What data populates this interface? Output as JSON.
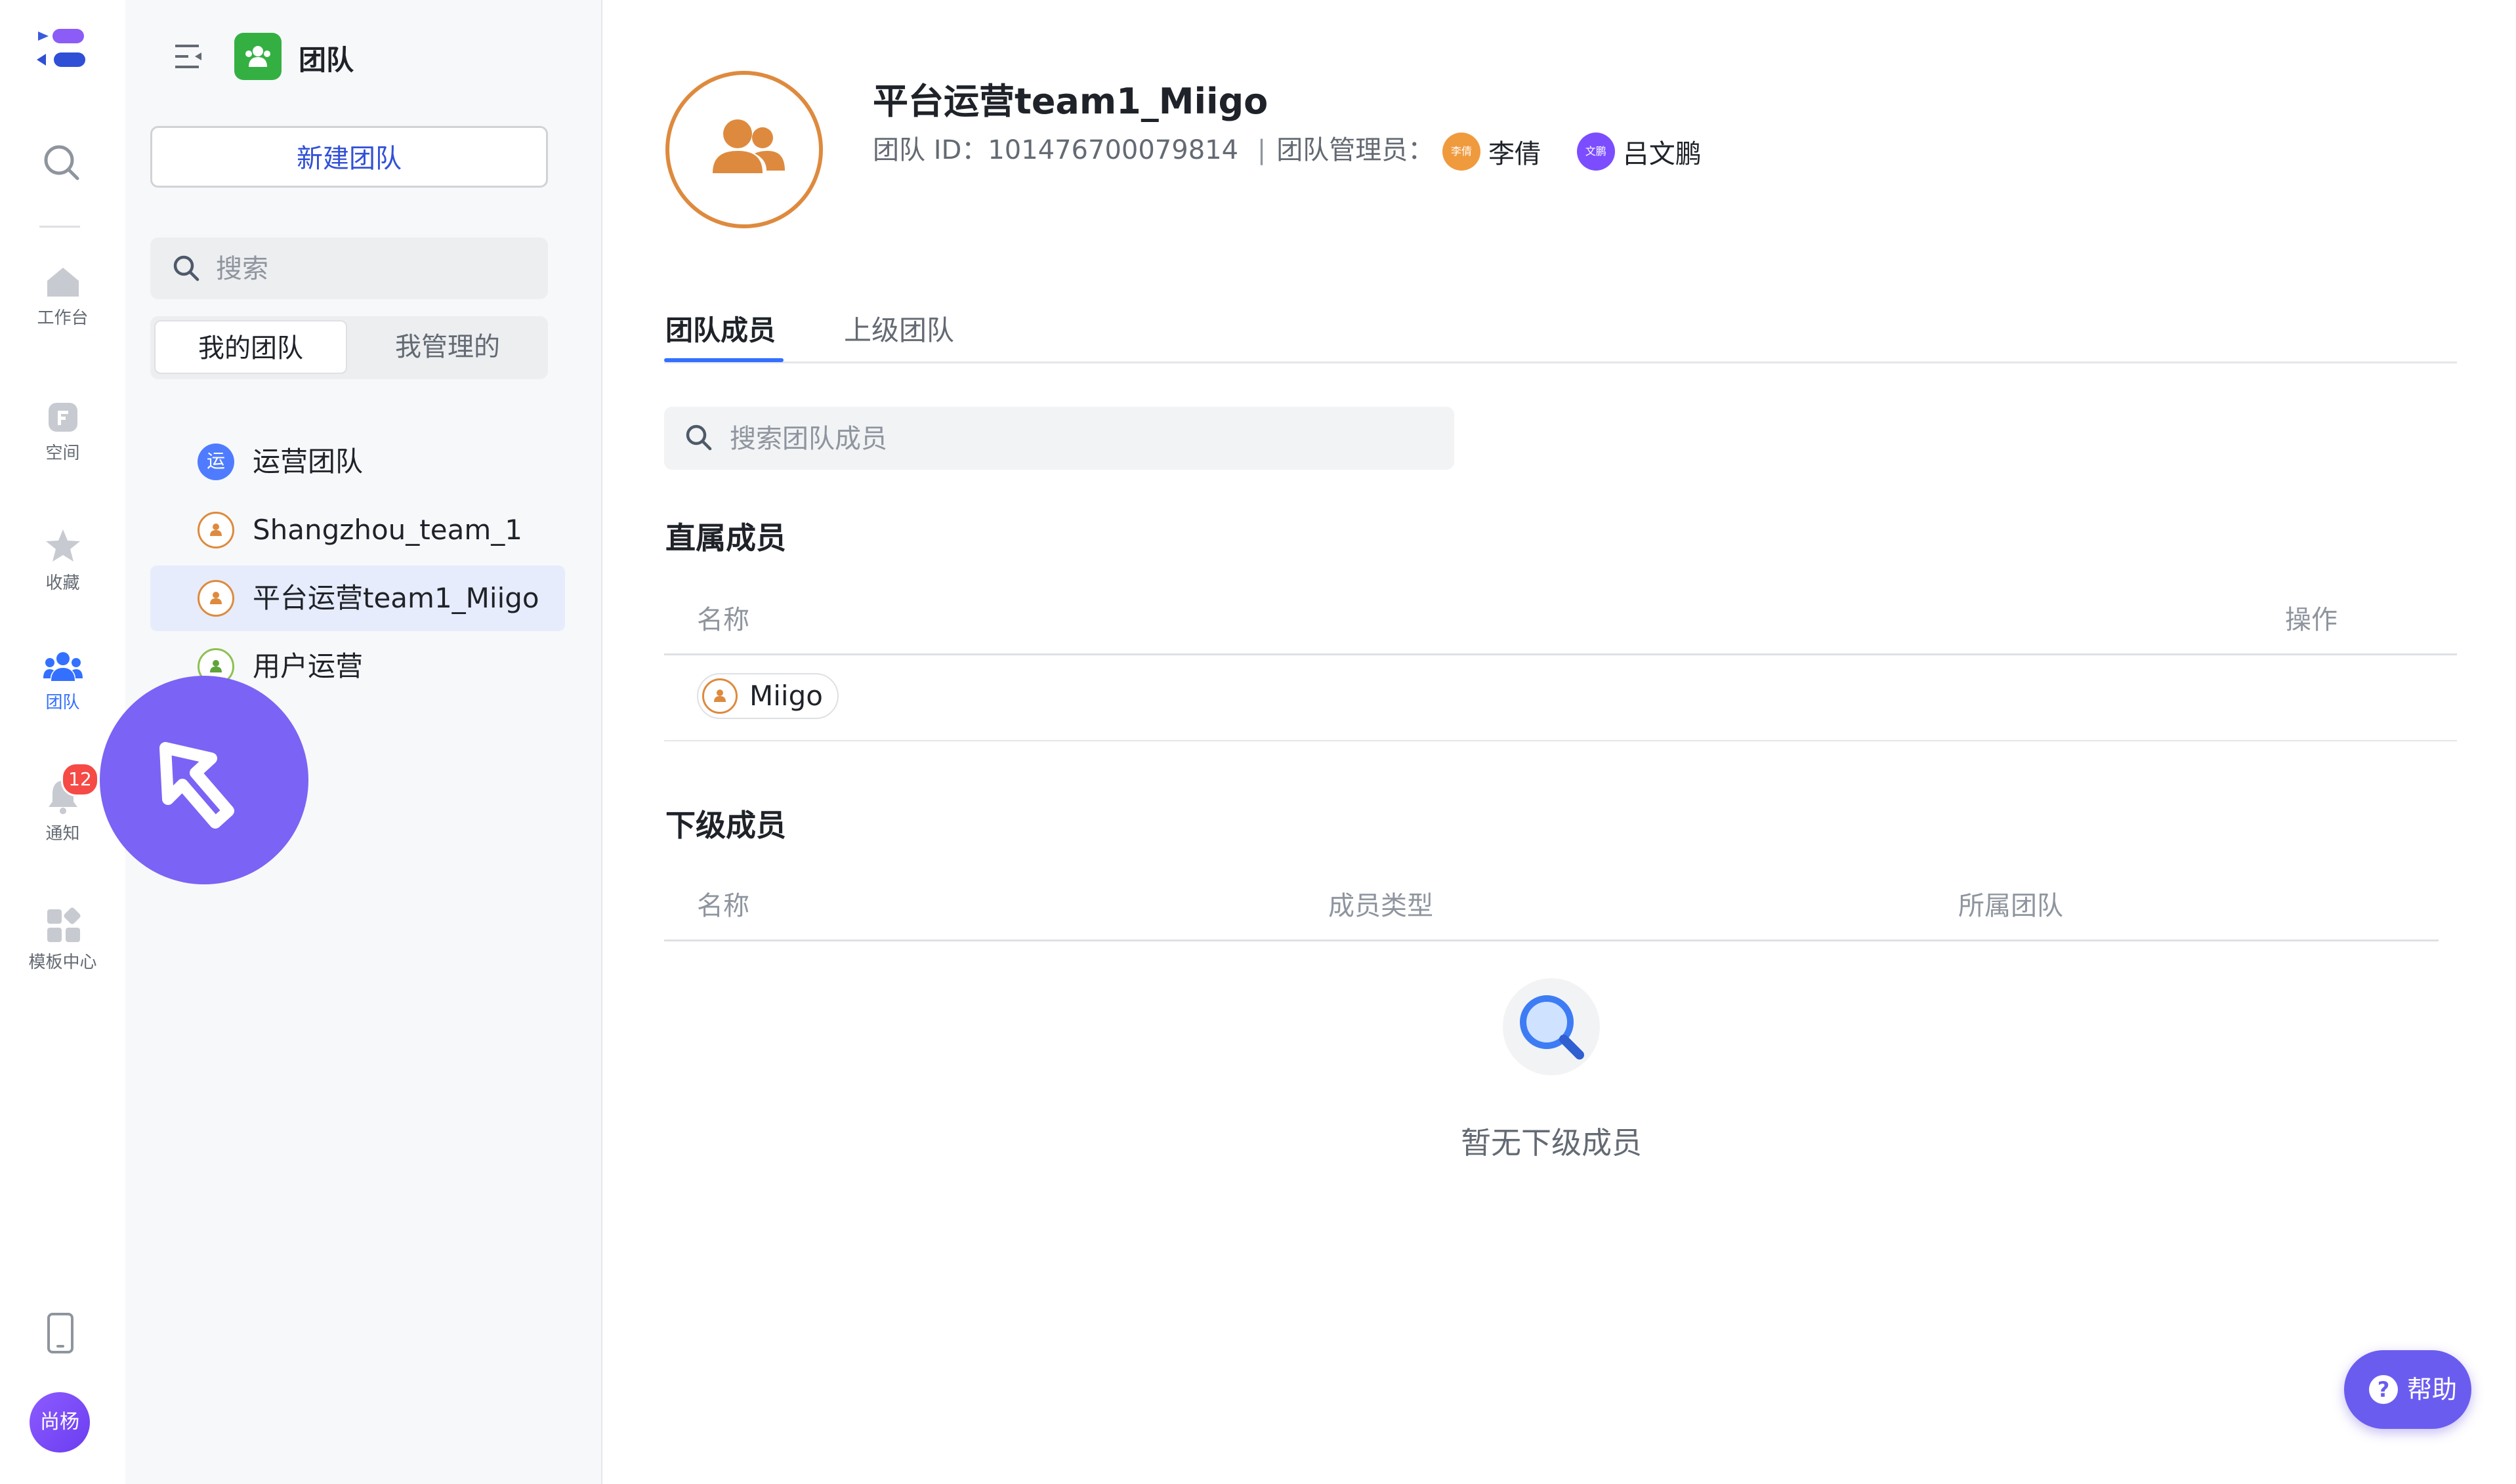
{
  "nav_rail": {
    "items": [
      {
        "name": "workspace",
        "label": "工作台",
        "icon": "home-icon"
      },
      {
        "name": "space",
        "label": "空间",
        "icon": "space-icon"
      },
      {
        "name": "favorites",
        "label": "收藏",
        "icon": "star-icon"
      },
      {
        "name": "team",
        "label": "团队",
        "icon": "team-icon",
        "active": true
      },
      {
        "name": "notify",
        "label": "通知",
        "icon": "bell-icon",
        "badge": "12"
      },
      {
        "name": "templates",
        "label": "模板中心",
        "icon": "grid-icon"
      }
    ],
    "notify_badge": "12",
    "user_avatar": "尚杨"
  },
  "sidebar": {
    "title": "团队",
    "new_team_label": "新建团队",
    "search_placeholder": "搜索",
    "segments": [
      "我的团队",
      "我管理的"
    ],
    "active_segment": 0,
    "teams": [
      {
        "label": "运营团队",
        "icon_text": "运",
        "style": "blue"
      },
      {
        "label": "Shangzhou_team_1",
        "style": "orange"
      },
      {
        "label": "平台运营team1_Miigo",
        "style": "orange",
        "selected": true
      },
      {
        "label": "用户运营",
        "style": "green"
      }
    ]
  },
  "team": {
    "title": "平台运营team1_Miigo",
    "id_label": "团队 ID：",
    "id_value": "101476700079814",
    "separator": "|",
    "managers_label": "团队管理员：",
    "managers": [
      {
        "badge": "李倩",
        "name": "李倩",
        "color": "#f09a3e"
      },
      {
        "badge": "文鹏",
        "name": "吕文鹏",
        "color": "#7c4dff"
      }
    ]
  },
  "tabs": [
    {
      "label": "团队成员",
      "active": true
    },
    {
      "label": "上级团队",
      "active": false
    }
  ],
  "member_search_placeholder": "搜索团队成员",
  "direct_members": {
    "title": "直属成员",
    "columns": [
      "名称",
      "操作"
    ],
    "rows": [
      {
        "name": "Miigo"
      }
    ]
  },
  "sub_members": {
    "title": "下级成员",
    "columns": [
      "名称",
      "成员类型",
      "所属团队"
    ],
    "empty_text": "暂无下级成员"
  },
  "help_label": "帮助",
  "help_icon_text": "?",
  "colors": {
    "accent": "#3370ff",
    "help": "#6b5cf0",
    "team_orange": "#de8a3e"
  }
}
